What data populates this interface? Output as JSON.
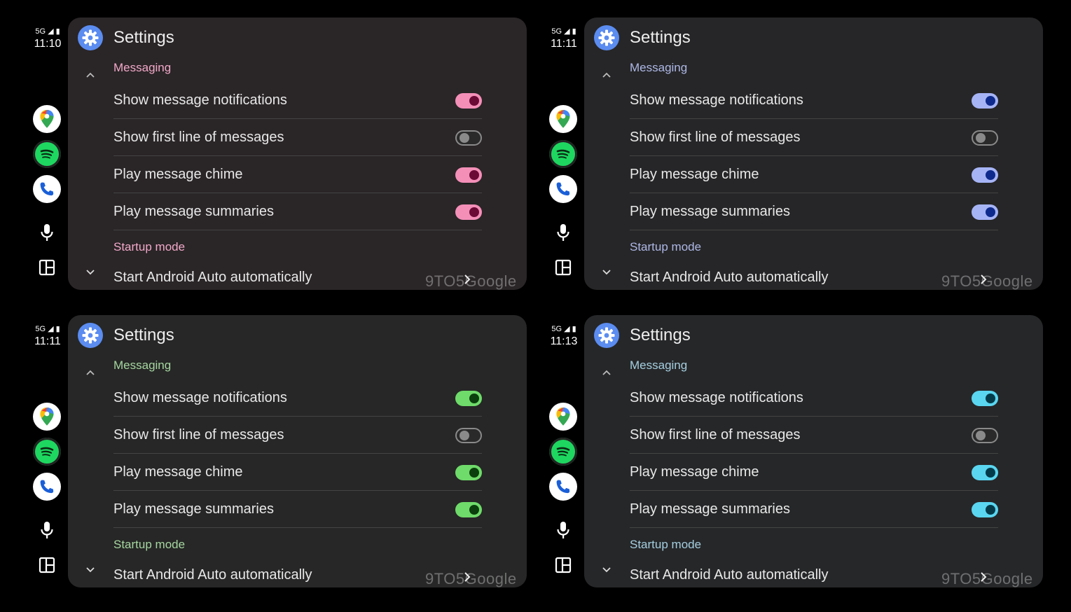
{
  "screens": [
    {
      "status_net": "5G",
      "time": "11:10",
      "theme": {
        "panel_bg": "#2a2527",
        "accent": "#f2a9c8",
        "toggle_track": "#f48fb8",
        "toggle_knob": "#6a0a35"
      },
      "title": "Settings",
      "section_messaging": "Messaging",
      "rows": [
        "Show message notifications",
        "Show first line of messages",
        "Play message chime",
        "Play message summaries"
      ],
      "toggles_on": [
        true,
        false,
        true,
        true
      ],
      "section_startup": "Startup mode",
      "start_label": "Start Android Auto automatically",
      "watermark": "9TO5Google"
    },
    {
      "status_net": "5G",
      "time": "11:11",
      "theme": {
        "panel_bg": "#262628",
        "accent": "#aeb8e6",
        "toggle_track": "#a6b4f6",
        "toggle_knob": "#0e2a8c"
      },
      "title": "Settings",
      "section_messaging": "Messaging",
      "rows": [
        "Show message notifications",
        "Show first line of messages",
        "Play message chime",
        "Play message summaries"
      ],
      "toggles_on": [
        true,
        false,
        true,
        true
      ],
      "section_startup": "Startup mode",
      "start_label": "Start Android Auto automatically",
      "watermark": "9TO5Google"
    },
    {
      "status_net": "5G",
      "time": "11:11",
      "theme": {
        "panel_bg": "#262726",
        "accent": "#a6d6a0",
        "toggle_track": "#6fdb6a",
        "toggle_knob": "#0b3f0d"
      },
      "title": "Settings",
      "section_messaging": "Messaging",
      "rows": [
        "Show message notifications",
        "Show first line of messages",
        "Play message chime",
        "Play message summaries"
      ],
      "toggles_on": [
        true,
        false,
        true,
        true
      ],
      "section_startup": "Startup mode",
      "start_label": "Start Android Auto automatically",
      "watermark": "9TO5Google"
    },
    {
      "status_net": "5G",
      "time": "11:13",
      "theme": {
        "panel_bg": "#262729",
        "accent": "#a5cfe0",
        "toggle_track": "#5ad6f0",
        "toggle_knob": "#043b4a"
      },
      "title": "Settings",
      "section_messaging": "Messaging",
      "rows": [
        "Show message notifications",
        "Show first line of messages",
        "Play message chime",
        "Play message summaries"
      ],
      "toggles_on": [
        true,
        false,
        true,
        true
      ],
      "section_startup": "Startup mode",
      "start_label": "Start Android Auto automatically",
      "watermark": "9TO5Google"
    }
  ]
}
